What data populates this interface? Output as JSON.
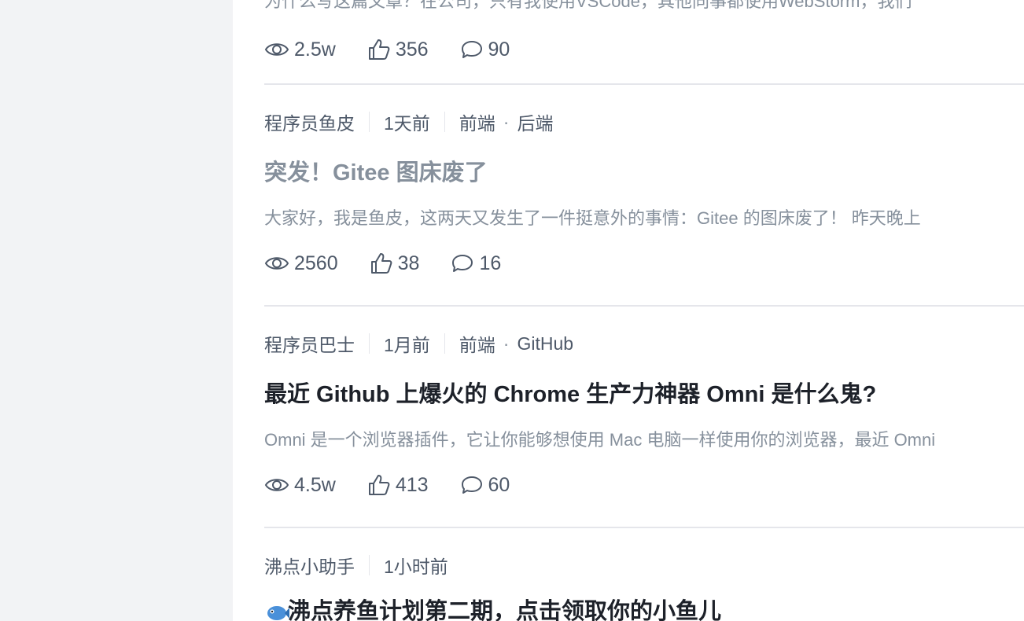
{
  "articles": [
    {
      "excerpt": "为什么写这篇文章？在公司，只有我使用VSCode，其他同事都使用WebStorm，我们",
      "stats": {
        "views": "2.5w",
        "likes": "356",
        "comments": "90"
      }
    },
    {
      "author": "程序员鱼皮",
      "time": "1天前",
      "tags": [
        "前端",
        "后端"
      ],
      "title": "突发！Gitee 图床废了",
      "excerpt": "大家好，我是鱼皮，这两天又发生了一件挺意外的事情：Gitee 的图床废了！ 昨天晚上",
      "stats": {
        "views": "2560",
        "likes": "38",
        "comments": "16"
      }
    },
    {
      "author": "程序员巴士",
      "time": "1月前",
      "tags": [
        "前端",
        "GitHub"
      ],
      "title": "最近 Github 上爆火的 Chrome 生产力神器 Omni 是什么鬼?",
      "excerpt": "Omni 是一个浏览器插件，它让你能够想使用 Mac 电脑一样使用你的浏览器，最近 Omni",
      "stats": {
        "views": "4.5w",
        "likes": "413",
        "comments": "60"
      }
    },
    {
      "author": "沸点小助手",
      "time": "1小时前",
      "title": "沸点养鱼计划第二期，点击领取你的小鱼儿"
    }
  ],
  "icons": {
    "views": "eye-icon",
    "likes": "thumbs-up-icon",
    "comments": "comment-icon",
    "emoji": "fish-emoji-icon"
  }
}
